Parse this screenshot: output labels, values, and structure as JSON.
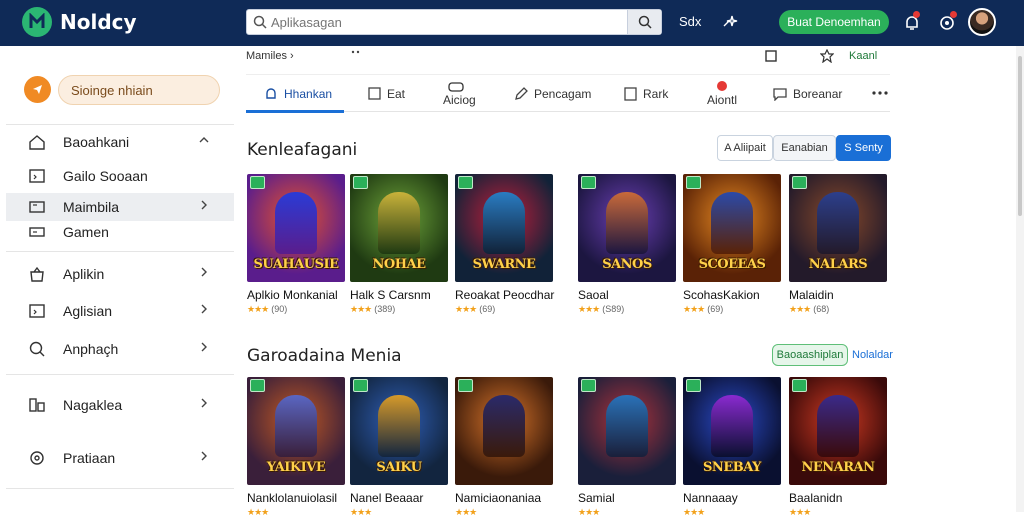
{
  "app": {
    "brand": "Noldcy"
  },
  "topbar": {
    "search_placeholder": "Aplikasagan",
    "link1": "Sdx",
    "cta_label": "Buat Denoemhan"
  },
  "sidebar": {
    "promo_label": "Sioinge nhiain",
    "items": [
      {
        "label": "Baoahkani"
      },
      {
        "label": "Gailo Sooaan"
      },
      {
        "label": "Maimbila"
      },
      {
        "label": "Gamen"
      },
      {
        "label": "Aplikin"
      },
      {
        "label": "Aglisian"
      },
      {
        "label": "Anphaçh"
      },
      {
        "label": "Nagaklea"
      },
      {
        "label": "Pratiaan"
      }
    ]
  },
  "breadcrumb": {
    "left": "Mamiles  ›",
    "right": "Kaanl"
  },
  "tabs": [
    {
      "label": "Hhankan"
    },
    {
      "label": "Eat"
    },
    {
      "label": "Aiciog"
    },
    {
      "label": "Pencagam"
    },
    {
      "label": "Rark"
    },
    {
      "label": "Aiontl"
    },
    {
      "label": "Boreanar"
    }
  ],
  "section1": {
    "title": "Kenleafagani",
    "filters": [
      "A Aliipait",
      "Eanabian",
      "S Senty"
    ],
    "cards": [
      {
        "overlay": "SUAHAUSIE",
        "name": "Aplkio Monkanial",
        "rating": "(90)"
      },
      {
        "overlay": "NOHAE",
        "name": "Halk S Carsnm",
        "rating": "(389)"
      },
      {
        "overlay": "SWARNE",
        "name": "Reoakat Peocdhar",
        "rating": "(69)"
      },
      {
        "overlay": "SANOS",
        "name": "Saoal",
        "rating": "(S89)"
      },
      {
        "overlay": "SCOEEAS",
        "name": "ScohasKakion",
        "rating": "(69)"
      },
      {
        "overlay": "NALARS",
        "name": "Malaidin",
        "rating": "(68)"
      }
    ]
  },
  "section2": {
    "title": "Garoadaina Menia",
    "chip": "Baoaashiplan",
    "link": "Nolaldar",
    "cards": [
      {
        "overlay": "YAIKIVE",
        "name": "Nanklolanuiolasil"
      },
      {
        "overlay": "SAIKU",
        "name": "Nanel Beaaar"
      },
      {
        "overlay": "",
        "name": "Namiciaonaniaa"
      },
      {
        "overlay": "",
        "name": "Samial"
      },
      {
        "overlay": "SNEBAY",
        "name": "Nannaaay"
      },
      {
        "overlay": "NENARAN",
        "name": "Baalanidn"
      }
    ]
  },
  "colors": {
    "topbar": "#0f2a57",
    "accent": "#1a6fd6",
    "cta": "#2bb05a"
  },
  "icons": [
    "search-icon",
    "bell-icon",
    "chevron-right-icon",
    "grid-icon",
    "more-icon"
  ]
}
